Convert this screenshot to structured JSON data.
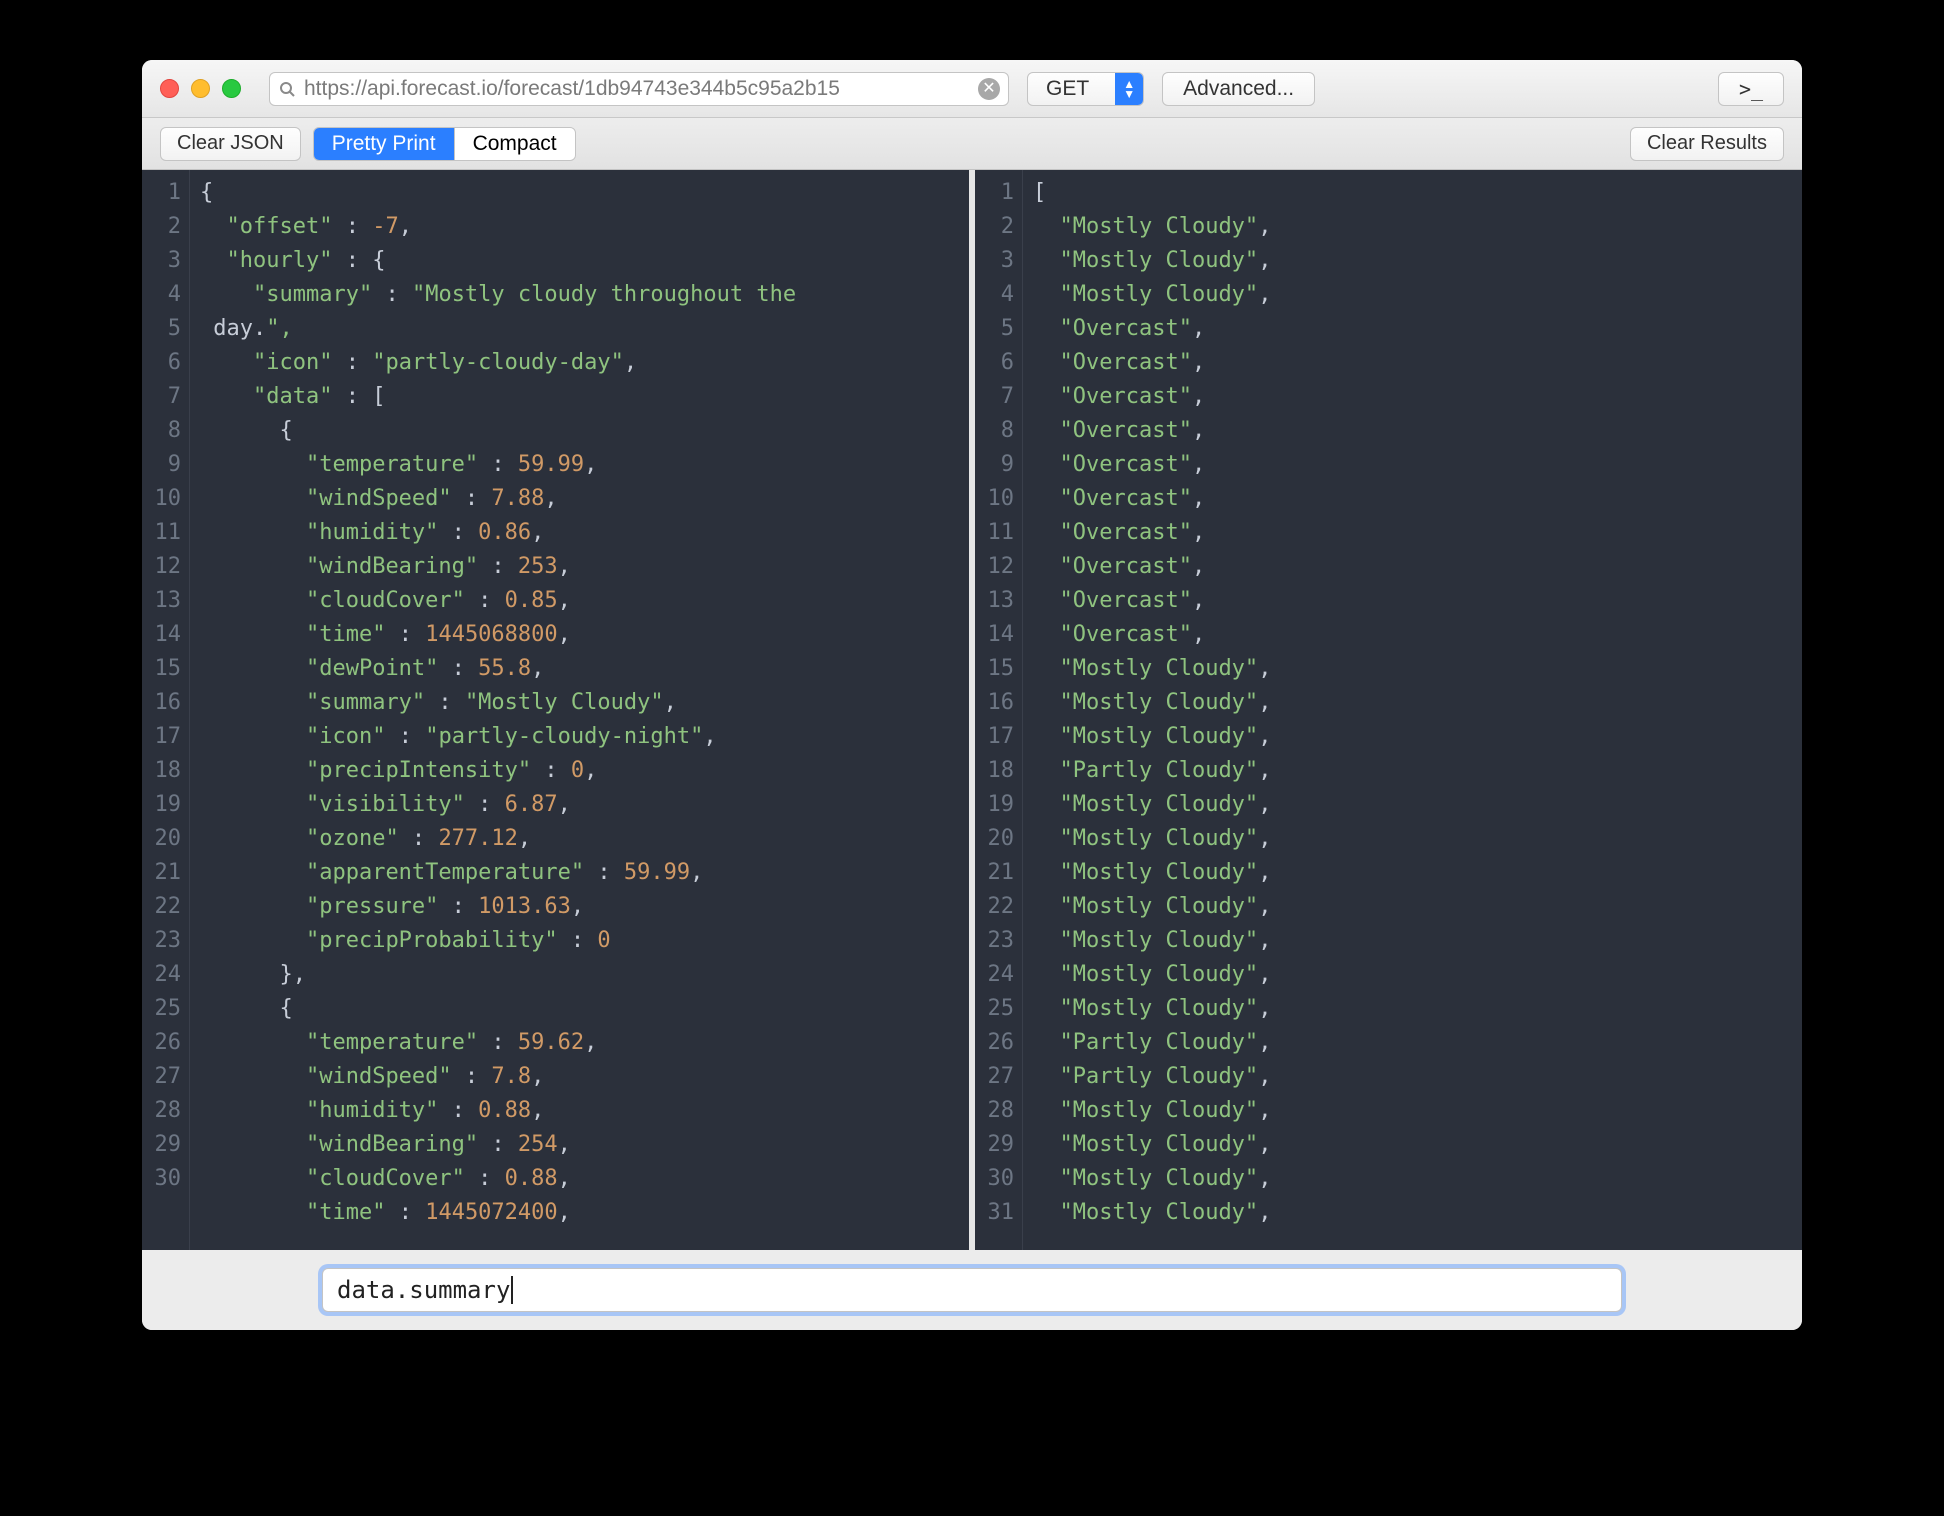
{
  "titlebar": {
    "url": "https://api.forecast.io/forecast/1db94743e344b5c95a2b15",
    "method": "GET",
    "advanced": "Advanced...",
    "console": ">_"
  },
  "toolbar": {
    "clear_json": "Clear JSON",
    "pretty": "Pretty Print",
    "compact": "Compact",
    "clear_results": "Clear Results"
  },
  "left_code": [
    "{",
    "  \"offset\" : -7,",
    "  \"hourly\" : {",
    "    \"summary\" : \"Mostly cloudy throughout the day.\",",
    "    \"icon\" : \"partly-cloudy-day\",",
    "    \"data\" : [",
    "      {",
    "        \"temperature\" : 59.99,",
    "        \"windSpeed\" : 7.88,",
    "        \"humidity\" : 0.86,",
    "        \"windBearing\" : 253,",
    "        \"cloudCover\" : 0.85,",
    "        \"time\" : 1445068800,",
    "        \"dewPoint\" : 55.8,",
    "        \"summary\" : \"Mostly Cloudy\",",
    "        \"icon\" : \"partly-cloudy-night\",",
    "        \"precipIntensity\" : 0,",
    "        \"visibility\" : 6.87,",
    "        \"ozone\" : 277.12,",
    "        \"apparentTemperature\" : 59.99,",
    "        \"pressure\" : 1013.63,",
    "        \"precipProbability\" : 0",
    "      },",
    "      {",
    "        \"temperature\" : 59.62,",
    "        \"windSpeed\" : 7.8,",
    "        \"humidity\" : 0.88,",
    "        \"windBearing\" : 254,",
    "        \"cloudCover\" : 0.88,",
    "        \"time\" : 1445072400,"
  ],
  "right_code": [
    "[",
    "  \"Mostly Cloudy\",",
    "  \"Mostly Cloudy\",",
    "  \"Mostly Cloudy\",",
    "  \"Overcast\",",
    "  \"Overcast\",",
    "  \"Overcast\",",
    "  \"Overcast\",",
    "  \"Overcast\",",
    "  \"Overcast\",",
    "  \"Overcast\",",
    "  \"Overcast\",",
    "  \"Overcast\",",
    "  \"Overcast\",",
    "  \"Mostly Cloudy\",",
    "  \"Mostly Cloudy\",",
    "  \"Mostly Cloudy\",",
    "  \"Partly Cloudy\",",
    "  \"Mostly Cloudy\",",
    "  \"Mostly Cloudy\",",
    "  \"Mostly Cloudy\",",
    "  \"Mostly Cloudy\",",
    "  \"Mostly Cloudy\",",
    "  \"Mostly Cloudy\",",
    "  \"Mostly Cloudy\",",
    "  \"Partly Cloudy\",",
    "  \"Partly Cloudy\",",
    "  \"Mostly Cloudy\",",
    "  \"Mostly Cloudy\",",
    "  \"Mostly Cloudy\",",
    "  \"Mostly Cloudy\","
  ],
  "query": "data.summary"
}
